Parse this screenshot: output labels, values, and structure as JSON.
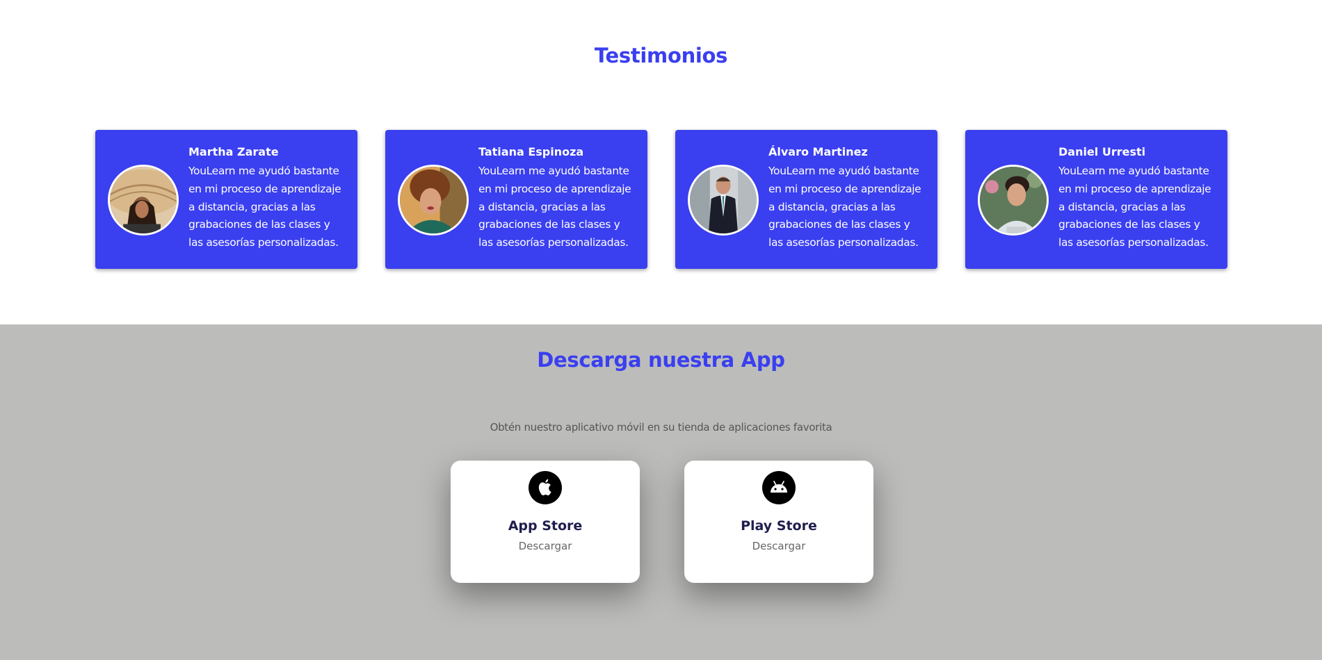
{
  "testimonials": {
    "title": "Testimonios",
    "items": [
      {
        "name": "Martha Zarate",
        "text": "YouLearn me ayudó bastante en mi proceso de aprendizaje a distancia, gracias a las grabaciones de las clases y las asesorías personalizadas."
      },
      {
        "name": "Tatiana Espinoza",
        "text": "YouLearn me ayudó bastante en mi proceso de aprendizaje a distancia, gracias a las grabaciones de las clases y las asesorías personalizadas."
      },
      {
        "name": "Álvaro Martinez",
        "text": "YouLearn me ayudó bastante en mi proceso de aprendizaje a distancia, gracias a las grabaciones de las clases y las asesorías personalizadas."
      },
      {
        "name": "Daniel Urresti",
        "text": "YouLearn me ayudó bastante en mi proceso de aprendizaje a distancia, gracias a las grabaciones de las clases y las asesorías personalizadas."
      }
    ]
  },
  "download": {
    "title": "Descarga nuestra App",
    "subtitle": "Obtén nuestro aplicativo móvil en su tienda de aplicaciones favorita",
    "stores": [
      {
        "name": "App Store",
        "action": "Descargar",
        "icon": "apple-icon"
      },
      {
        "name": "Play Store",
        "action": "Descargar",
        "icon": "android-icon"
      }
    ]
  },
  "colors": {
    "accent": "#3a3ff0",
    "download_bg": "#bcbdbb",
    "store_title": "#1f1d4d"
  }
}
